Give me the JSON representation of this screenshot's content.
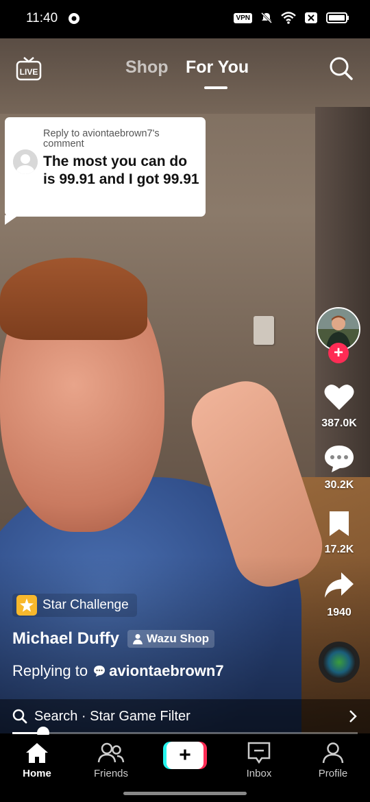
{
  "status_bar": {
    "time": "11:40",
    "vpn_label": "VPN"
  },
  "top_nav": {
    "live_label": "LIVE",
    "tabs": [
      {
        "label": "Shop",
        "active": false
      },
      {
        "label": "For You",
        "active": true
      }
    ]
  },
  "reply_card": {
    "header": "Reply to aviontaebrown7's comment",
    "comment": "The most you can do is 99.91 and I got 99.91"
  },
  "actions": {
    "likes": "387.0K",
    "comments": "30.2K",
    "saves": "17.2K",
    "shares": "1940"
  },
  "caption": {
    "badge_label": "Star Challenge",
    "creator_name": "Michael Duffy",
    "shop_label": "Wazu Shop",
    "replying_prefix": "Replying to",
    "replying_user": "aviontaebrown7"
  },
  "search_bar": {
    "text": "Search · Star Game Filter"
  },
  "playback": {
    "progress_fraction": 0.09
  },
  "tab_bar": {
    "home": "Home",
    "friends": "Friends",
    "inbox": "Inbox",
    "profile": "Profile"
  },
  "colors": {
    "accent_red": "#fe2c55",
    "accent_cyan": "#25f4ee",
    "star_yellow": "#f8b82c"
  }
}
